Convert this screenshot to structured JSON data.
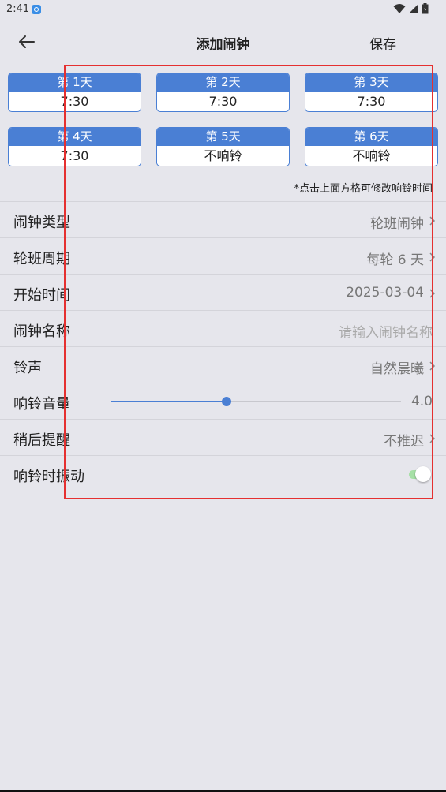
{
  "status_bar": {
    "time": "2:41",
    "icons": [
      "wifi-icon",
      "cell-signal-icon",
      "battery-icon"
    ]
  },
  "header": {
    "title": "添加闹钟",
    "save_label": "保存",
    "back_icon": "arrow-left-icon"
  },
  "days": [
    {
      "label": "第 1天",
      "time": "7:30"
    },
    {
      "label": "第 2天",
      "time": "7:30"
    },
    {
      "label": "第 3天",
      "time": "7:30"
    },
    {
      "label": "第 4天",
      "time": "7:30"
    },
    {
      "label": "第 5天",
      "time": "不响铃"
    },
    {
      "label": "第 6天",
      "time": "不响铃"
    }
  ],
  "hint": "*点击上面方格可修改响铃时间",
  "settings": {
    "alarm_type": {
      "label": "闹钟类型",
      "value": "轮班闹钟"
    },
    "cycle": {
      "label": "轮班周期",
      "value": "每轮 6 天"
    },
    "start_time": {
      "label": "开始时间",
      "value": "2025-03-04"
    },
    "alarm_name": {
      "label": "闹钟名称",
      "placeholder": "请输入闹钟名称"
    },
    "ringtone": {
      "label": "铃声",
      "value": "自然晨曦"
    },
    "volume": {
      "label": "响铃音量",
      "value": "4.0",
      "level_fraction": 0.4
    },
    "snooze": {
      "label": "稍后提醒",
      "value": "不推迟"
    },
    "vibrate": {
      "label": "响铃时振动",
      "enabled": true
    }
  },
  "colors": {
    "accent": "#4a7fd4",
    "highlight": "#e53030",
    "background": "#e6e6ec",
    "toggle_on": "#a6e0a6"
  }
}
